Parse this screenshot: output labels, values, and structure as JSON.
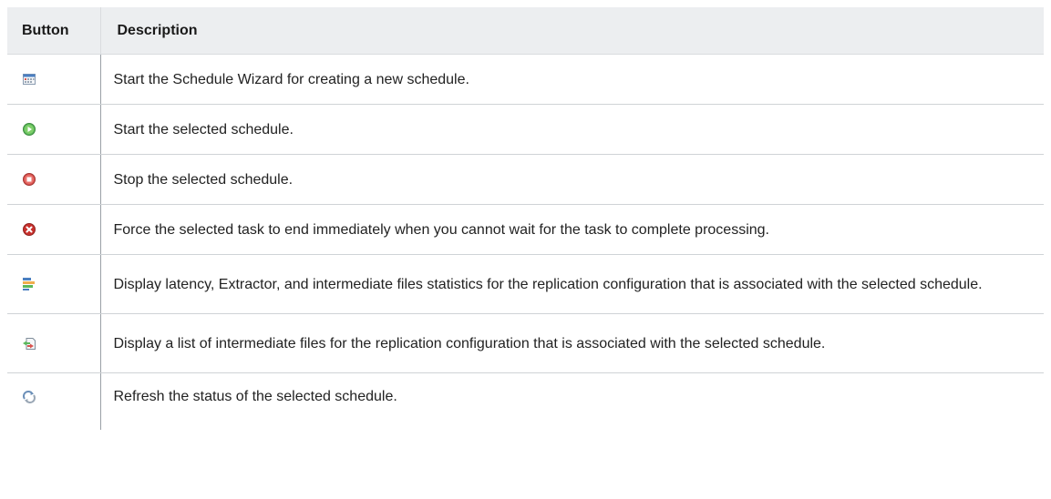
{
  "table": {
    "headers": {
      "button": "Button",
      "description": "Description"
    },
    "rows": [
      {
        "icon": "calendar-wizard-icon",
        "description": "Start the Schedule Wizard for creating a new schedule."
      },
      {
        "icon": "start-play-icon",
        "description": "Start the selected schedule."
      },
      {
        "icon": "stop-icon",
        "description": "Stop the selected schedule."
      },
      {
        "icon": "force-end-icon",
        "description": "Force the selected task to end immediately when you cannot wait for the task to complete processing."
      },
      {
        "icon": "statistics-bars-icon",
        "description": "Display latency, Extractor, and intermediate files statistics for the replication configuration that is associated with the selected schedule."
      },
      {
        "icon": "intermediate-files-icon",
        "description": "Display a list of intermediate files for the replication configuration that is associated with the selected schedule."
      },
      {
        "icon": "refresh-icon",
        "description": "Refresh the status of the selected schedule."
      }
    ]
  },
  "colors": {
    "header_bg": "#eceef0",
    "start_green": "#5cb85c",
    "stop_red": "#d9534f"
  }
}
